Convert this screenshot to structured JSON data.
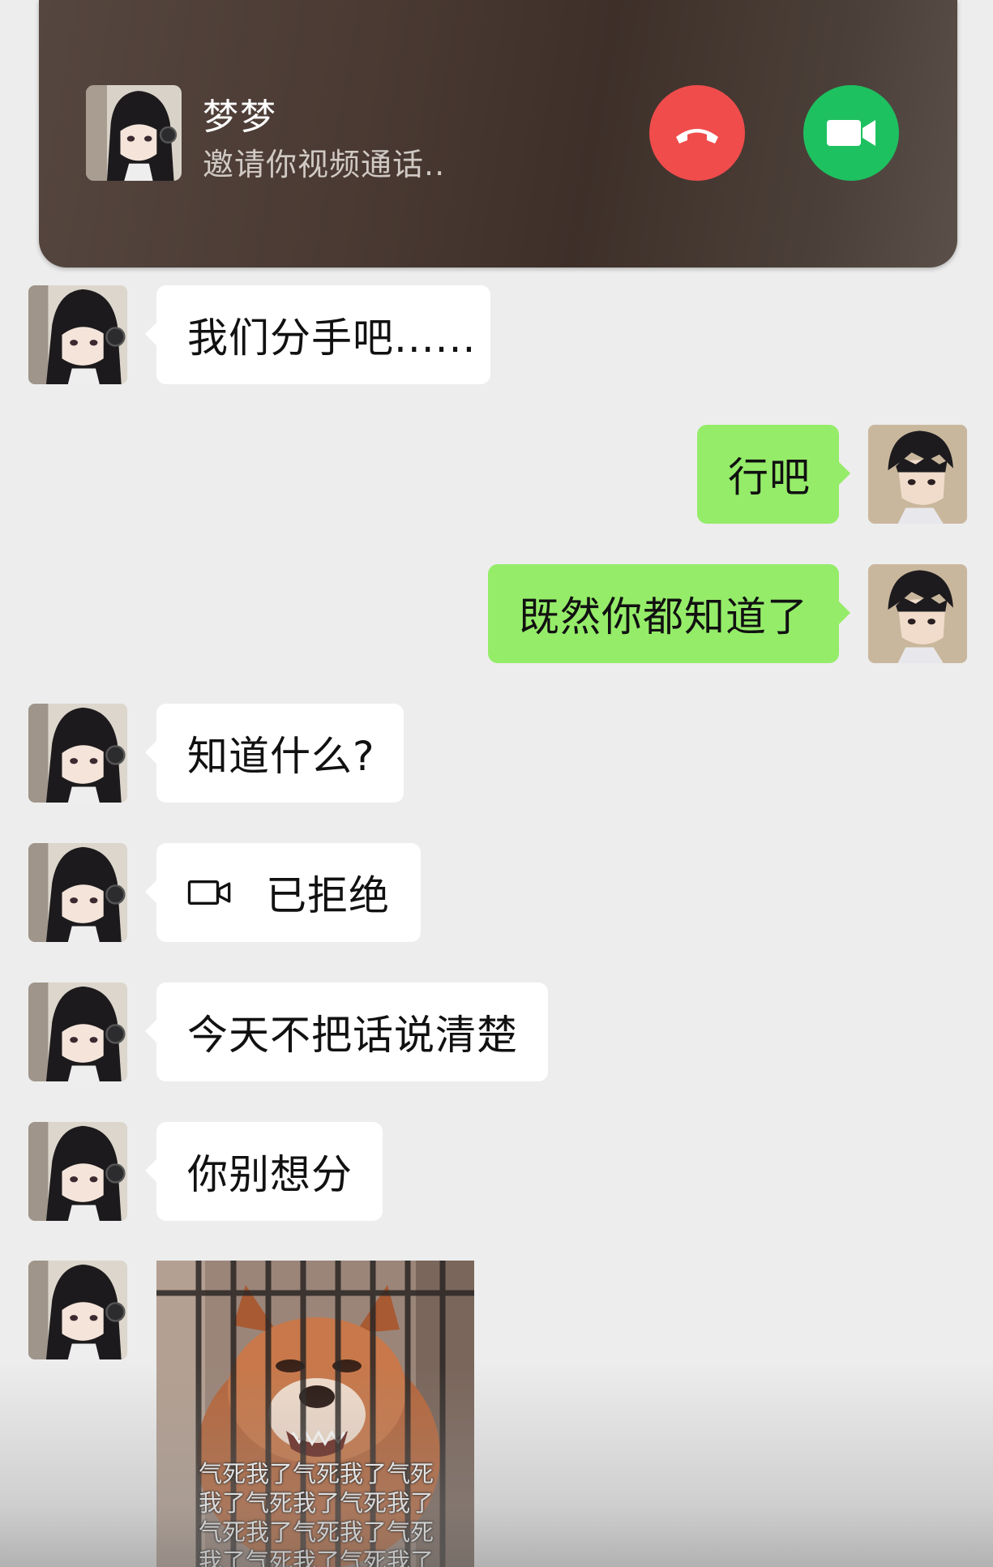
{
  "call": {
    "caller_name": "梦梦",
    "status": "邀请你视频通话..",
    "decline_icon": "phone-hangup-icon",
    "accept_icon": "video-camera-icon",
    "decline_color": "#f04c4c",
    "accept_color": "#1ec160"
  },
  "messages": [
    {
      "side": "left",
      "text": "我们分手吧......"
    },
    {
      "side": "right",
      "text": "行吧"
    },
    {
      "side": "right",
      "text": "既然你都知道了"
    },
    {
      "side": "left",
      "text": "知道什么?"
    },
    {
      "side": "left",
      "text": "已拒绝",
      "icon": "video-call-icon"
    },
    {
      "side": "left",
      "text": "今天不把话说清楚"
    },
    {
      "side": "left",
      "text": "你别想分"
    },
    {
      "side": "left",
      "type": "sticker",
      "caption": "气死我了气死我了气死\n我了气死我了气死我了\n气死我了气死我了气死\n我了气死我了气死我了"
    }
  ],
  "colors": {
    "background": "#ededed",
    "sent_bubble": "#95ec69",
    "received_bubble": "#ffffff"
  }
}
